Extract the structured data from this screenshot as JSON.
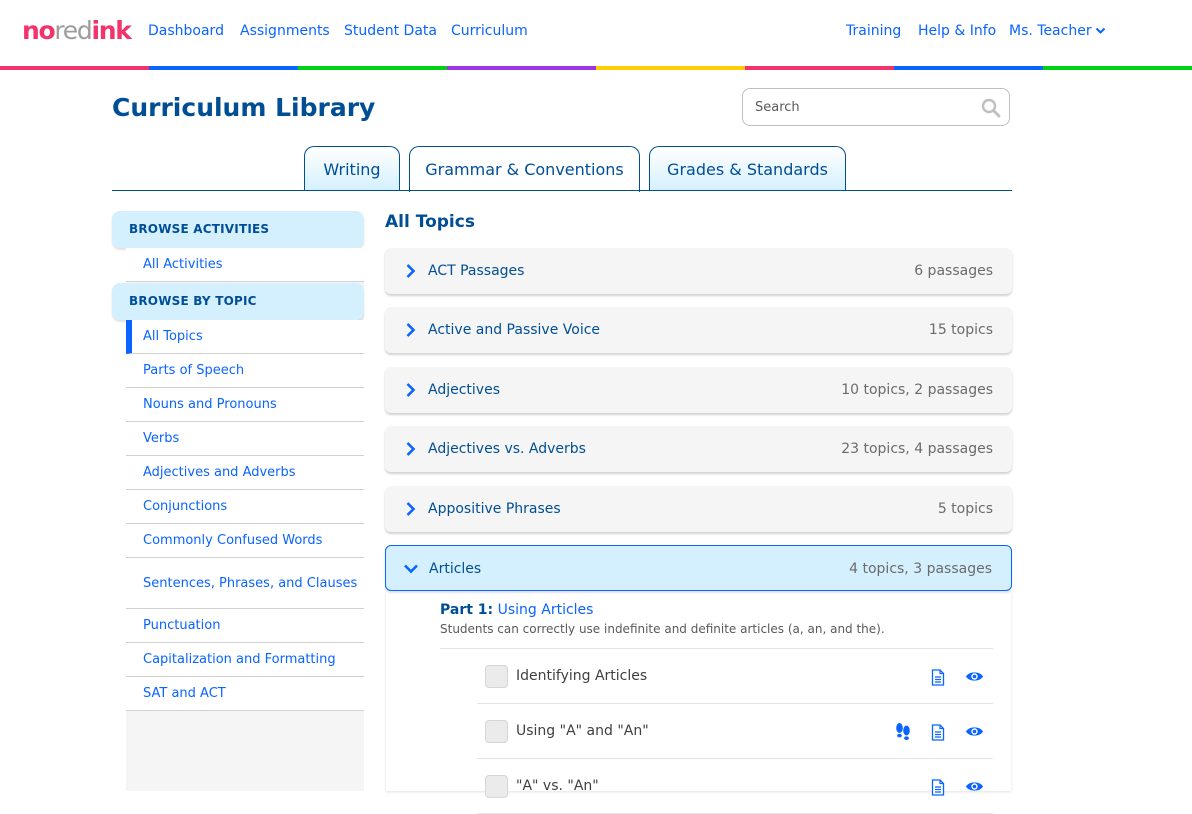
{
  "brand": {
    "logo_no": "no",
    "logo_red": "red",
    "logo_ink": "ink"
  },
  "nav": {
    "links": [
      "Dashboard",
      "Assignments",
      "Student Data",
      "Curriculum"
    ],
    "right_links": [
      "Training",
      "Help & Info"
    ],
    "user_menu": "Ms. Teacher"
  },
  "rainbow_colors": [
    "#f3336c",
    "#0a64ff",
    "#00d114",
    "#9e36e6",
    "#ffce00",
    "#f3336c",
    "#0a64ff",
    "#00d114"
  ],
  "colors": {
    "navy": "#004e95",
    "blue": "#0a64ff",
    "glacier": "#d4f0ff",
    "panel": "#f5f5f5"
  },
  "page": {
    "title": "Curriculum Library",
    "search": {
      "placeholder": "Search",
      "value": ""
    }
  },
  "tabs": [
    {
      "label": "Writing",
      "active": false
    },
    {
      "label": "Grammar & Conventions",
      "active": true
    },
    {
      "label": "Grades & Standards",
      "active": false
    }
  ],
  "sidebar": {
    "browse_activities": {
      "heading": "BROWSE ACTIVITIES",
      "items": [
        "All Activities"
      ]
    },
    "browse_by_topic": {
      "heading": "BROWSE BY TOPIC",
      "items": [
        "All Topics",
        "Parts of Speech",
        "Nouns and Pronouns",
        "Verbs",
        "Adjectives and Adverbs",
        "Conjunctions",
        "Commonly Confused Words",
        "Sentences, Phrases, and Clauses",
        "Punctuation",
        "Capitalization and Formatting",
        "SAT and ACT"
      ],
      "selected": "All Topics"
    }
  },
  "main": {
    "heading": "All Topics",
    "topics": [
      {
        "name": "ACT Passages",
        "count": "6 passages",
        "expanded": false
      },
      {
        "name": "Active and Passive Voice",
        "count": "15 topics",
        "expanded": false
      },
      {
        "name": "Adjectives",
        "count": "10 topics, 2 passages",
        "expanded": false
      },
      {
        "name": "Adjectives vs. Adverbs",
        "count": "23 topics, 4 passages",
        "expanded": false
      },
      {
        "name": "Appositive Phrases",
        "count": "5 topics",
        "expanded": false
      },
      {
        "name": "Articles",
        "count": "4 topics, 3 passages",
        "expanded": true
      }
    ],
    "expanded_topic": {
      "part_label": "Part 1:",
      "part_title": "Using Articles",
      "part_description": "Students can correctly use indefinite and definite articles (a, an, and the).",
      "activities": [
        {
          "name": "Identifying Articles",
          "icons": [
            "doc-icon",
            "eye-icon"
          ]
        },
        {
          "name": "Using \"A\" and \"An\"",
          "icons": [
            "footsteps-icon",
            "doc-icon",
            "eye-icon"
          ]
        },
        {
          "name": "\"A\" vs. \"An\"",
          "icons": [
            "doc-icon",
            "eye-icon"
          ]
        }
      ]
    }
  }
}
